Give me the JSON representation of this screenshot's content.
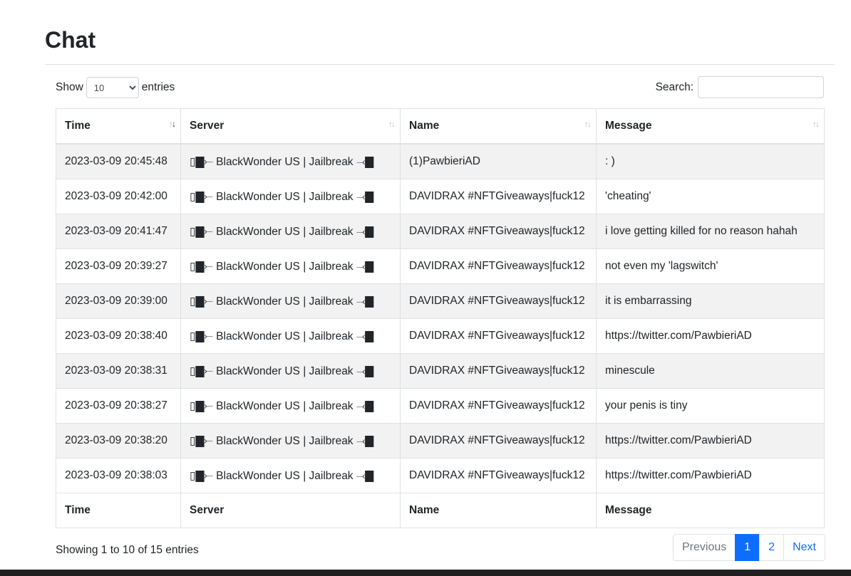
{
  "page": {
    "title": "Chat"
  },
  "length": {
    "show_label": "Show",
    "selected": "10",
    "entries_label": "entries"
  },
  "search": {
    "label": "Search:",
    "value": ""
  },
  "table": {
    "headers": {
      "time": "Time",
      "server": "Server",
      "name": "Name",
      "message": "Message"
    },
    "rows": [
      {
        "time": "2023-03-09 20:45:48",
        "server": "▯▇⤚ BlackWonder US | Jailbreak ⤙▇",
        "name": "(1)PawbieriAD",
        "message": ": )"
      },
      {
        "time": "2023-03-09 20:42:00",
        "server": "▯▇⤚ BlackWonder US | Jailbreak ⤙▇",
        "name": "DAVIDRAX #NFTGiveaways|fuck12",
        "message": "'cheating'"
      },
      {
        "time": "2023-03-09 20:41:47",
        "server": "▯▇⤚ BlackWonder US | Jailbreak ⤙▇",
        "name": "DAVIDRAX #NFTGiveaways|fuck12",
        "message": "i love getting killed for no reason hahah"
      },
      {
        "time": "2023-03-09 20:39:27",
        "server": "▯▇⤚ BlackWonder US | Jailbreak ⤙▇",
        "name": "DAVIDRAX #NFTGiveaways|fuck12",
        "message": "not even my 'lagswitch'"
      },
      {
        "time": "2023-03-09 20:39:00",
        "server": "▯▇⤚ BlackWonder US | Jailbreak ⤙▇",
        "name": "DAVIDRAX #NFTGiveaways|fuck12",
        "message": "it is embarrassing"
      },
      {
        "time": "2023-03-09 20:38:40",
        "server": "▯▇⤚ BlackWonder US | Jailbreak ⤙▇",
        "name": "DAVIDRAX #NFTGiveaways|fuck12",
        "message": "https://twitter.com/PawbieriAD"
      },
      {
        "time": "2023-03-09 20:38:31",
        "server": "▯▇⤚ BlackWonder US | Jailbreak ⤙▇",
        "name": "DAVIDRAX #NFTGiveaways|fuck12",
        "message": "minescule"
      },
      {
        "time": "2023-03-09 20:38:27",
        "server": "▯▇⤚ BlackWonder US | Jailbreak ⤙▇",
        "name": "DAVIDRAX #NFTGiveaways|fuck12",
        "message": "your penis is tiny"
      },
      {
        "time": "2023-03-09 20:38:20",
        "server": "▯▇⤚ BlackWonder US | Jailbreak ⤙▇",
        "name": "DAVIDRAX #NFTGiveaways|fuck12",
        "message": "https://twitter.com/PawbieriAD"
      },
      {
        "time": "2023-03-09 20:38:03",
        "server": "▯▇⤚ BlackWonder US | Jailbreak ⤙▇",
        "name": "DAVIDRAX #NFTGiveaways|fuck12",
        "message": "https://twitter.com/PawbieriAD"
      }
    ]
  },
  "info": "Showing 1 to 10 of 15 entries",
  "pagination": {
    "previous": "Previous",
    "page1": "1",
    "page2": "2",
    "next": "Next"
  },
  "icons": {
    "sort": "sort-arrows-icon"
  },
  "colors": {
    "accent": "#0d6efd",
    "stripe": "#f2f2f2",
    "border": "#dee2e6"
  }
}
